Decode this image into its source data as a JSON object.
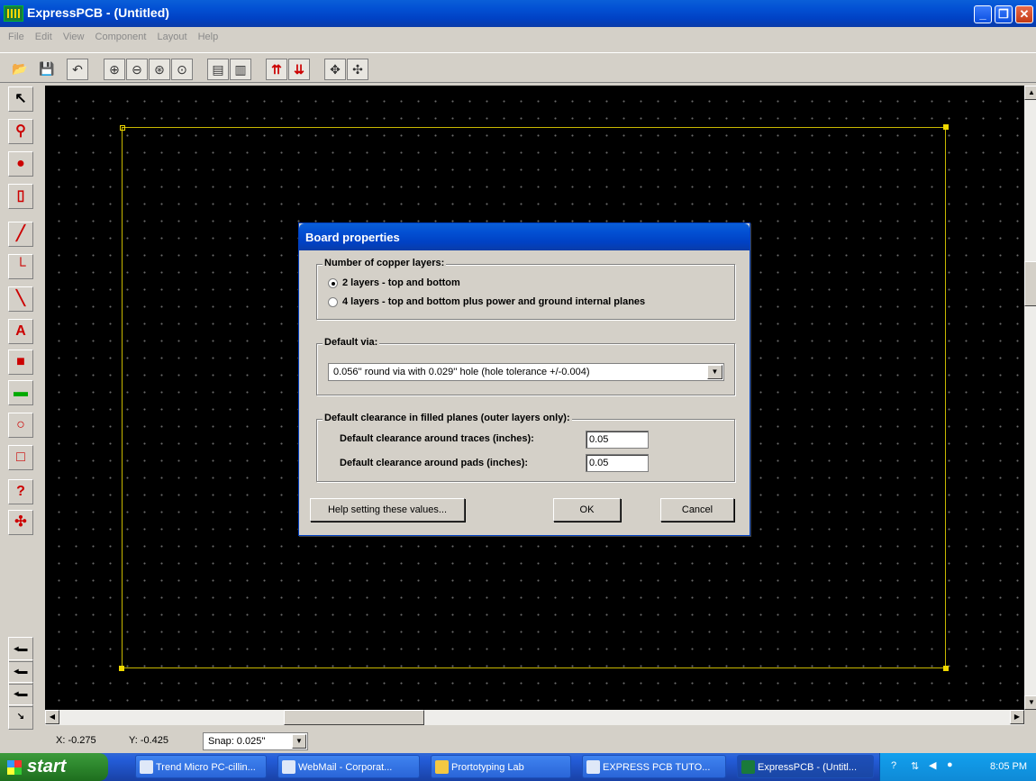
{
  "window": {
    "title": "ExpressPCB - (Untitled)",
    "min": "_",
    "max": "❐",
    "close": "✕"
  },
  "menu": [
    "File",
    "Edit",
    "View",
    "Component",
    "Layout",
    "Help"
  ],
  "toolbar": [
    "open-icon",
    "save-icon",
    "undo-icon",
    "zoom-in-icon",
    "zoom-out-icon",
    "zoom-fit-icon",
    "zoom-previous-icon",
    "board-properties-icon",
    "part-properties-icon",
    "layer-top-icon",
    "layer-bottom-icon",
    "move-icon",
    "rotate-icon"
  ],
  "tools": [
    "pointer-icon",
    "zoom-tool-icon",
    "pad-tool-icon",
    "component-tool-icon",
    "trace-tool-icon",
    "trace-corner-icon",
    "diagonal-trace-icon",
    "text-tool-icon",
    "filled-plane-icon",
    "component-place-icon",
    "circle-tool-icon",
    "rectangle-tool-icon",
    "via-query-icon",
    "connections-icon"
  ],
  "layer_tools": [
    "layer-select-1-icon",
    "layer-select-2-icon",
    "layer-select-3-icon",
    "layer-select-4-icon"
  ],
  "dialog": {
    "title": "Board properties",
    "copper": {
      "legend": "Number of copper layers:",
      "opt1": "2 layers - top and bottom",
      "opt2": "4 layers - top and bottom plus power and ground internal planes",
      "selected": 1
    },
    "via": {
      "legend": "Default via:",
      "value": "0.056'' round via with 0.029'' hole  (hole tolerance +/-0.004)"
    },
    "clearance": {
      "legend": "Default clearance in filled planes (outer layers only):",
      "traces_label": "Default clearance around traces (inches):",
      "traces_value": "0.05",
      "pads_label": "Default clearance around pads (inches):",
      "pads_value": "0.05"
    },
    "help_button": "Help setting these values...",
    "ok_button": "OK",
    "cancel_button": "Cancel"
  },
  "status": {
    "x": "X: -0.275",
    "y": "Y: -0.425",
    "snap": "Snap:  0.025''"
  },
  "taskbar": {
    "start": "start",
    "tasks": [
      "Trend Micro PC-cillin...",
      "WebMail - Corporat...",
      "Prortotyping Lab",
      "EXPRESS PCB TUTO...",
      "ExpressPCB - (Untitl..."
    ],
    "clock": "8:05 PM"
  },
  "colors": {
    "board_outline": "#c8b800",
    "canvas": "#000000",
    "titlebar": "#0351d4"
  }
}
